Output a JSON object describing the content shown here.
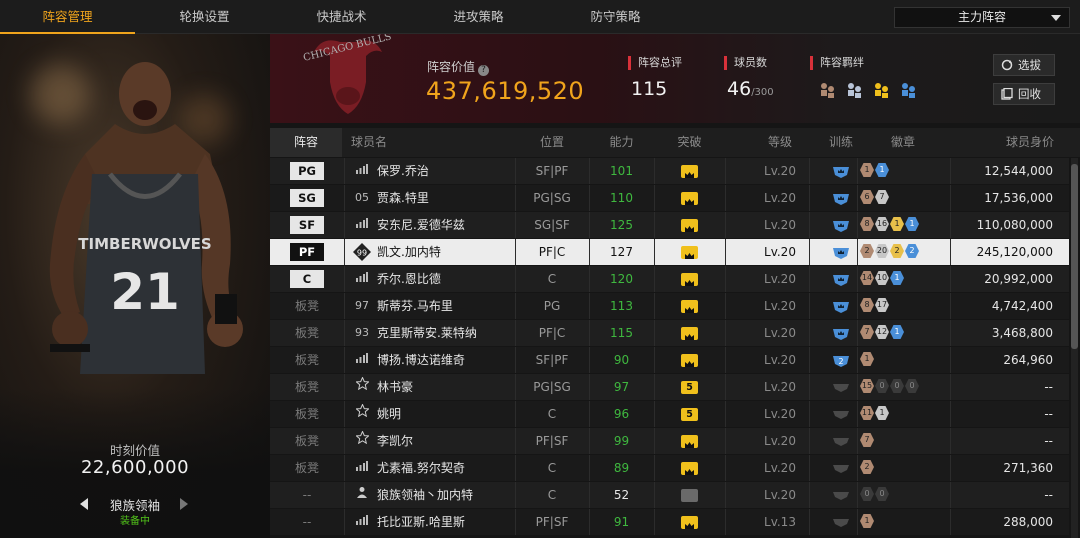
{
  "tabs": [
    {
      "label": "阵容管理",
      "active": true
    },
    {
      "label": "轮换设置",
      "active": false
    },
    {
      "label": "快捷战术",
      "active": false
    },
    {
      "label": "进攻策略",
      "active": false
    },
    {
      "label": "防守策略",
      "active": false
    }
  ],
  "lineup_select": {
    "value": "主力阵容"
  },
  "player_card": {
    "moment_label": "时刻价值",
    "moment_value": "22,600,000",
    "name": "狼族领袖",
    "status": "装备中",
    "jersey": "21",
    "team_text": "TIMBERWOLVES"
  },
  "team": {
    "logo_text": "CHICAGO BULLS",
    "value_label": "阵容价值",
    "value": "437,619,520",
    "rating_label": "阵容总评",
    "rating": "115",
    "count_label": "球员数",
    "count": "46",
    "count_max": "/300",
    "bond_label": "阵容羁绊",
    "select_button": "选拔",
    "recycle_button": "回收"
  },
  "table": {
    "headers": [
      "阵容",
      "球员名",
      "位置",
      "能力",
      "突破",
      "等级",
      "训练",
      "徽章",
      "球员身价"
    ],
    "rows": [
      {
        "slot": "PG",
        "icon": "bars-icon",
        "num": "",
        "name": "保罗.乔治",
        "pos": "SF|PF",
        "ability": "101",
        "ability_color": "green",
        "breakthrough": "gold",
        "level": "Lv.20",
        "train": "blue",
        "badges": [
          {
            "c": "bronze",
            "t": "1"
          },
          {
            "c": "blue",
            "t": "1"
          }
        ],
        "price": "12,544,000"
      },
      {
        "slot": "SG",
        "icon": "",
        "num": "05",
        "name": "贾森.特里",
        "pos": "PG|SG",
        "ability": "110",
        "ability_color": "green",
        "breakthrough": "gold",
        "level": "Lv.20",
        "train": "blue",
        "badges": [
          {
            "c": "bronze",
            "t": "6"
          },
          {
            "c": "silver",
            "t": "7"
          }
        ],
        "price": "17,536,000"
      },
      {
        "slot": "SF",
        "icon": "bars-icon",
        "num": "",
        "name": "安东尼.爱德华兹",
        "pos": "SG|SF",
        "ability": "125",
        "ability_color": "green",
        "breakthrough": "gold",
        "level": "Lv.20",
        "train": "blue",
        "badges": [
          {
            "c": "bronze",
            "t": "8"
          },
          {
            "c": "silver",
            "t": "16"
          },
          {
            "c": "gold",
            "t": "1"
          },
          {
            "c": "blue",
            "t": "1"
          }
        ],
        "price": "110,080,000"
      },
      {
        "slot": "PF",
        "icon": "diamond-icon",
        "num": "99",
        "name": "凯文.加内特",
        "pos": "PF|C",
        "ability": "127",
        "ability_color": "white",
        "breakthrough": "gold",
        "level": "Lv.20",
        "train": "blue",
        "badges": [
          {
            "c": "bronze",
            "t": "2"
          },
          {
            "c": "silver",
            "t": "20"
          },
          {
            "c": "gold",
            "t": "2"
          },
          {
            "c": "blue",
            "t": "2"
          }
        ],
        "price": "245,120,000",
        "selected": true
      },
      {
        "slot": "C",
        "icon": "bars-icon",
        "num": "",
        "name": "乔尔.恩比德",
        "pos": "C",
        "ability": "120",
        "ability_color": "green",
        "breakthrough": "gold",
        "level": "Lv.20",
        "train": "blue",
        "badges": [
          {
            "c": "bronze",
            "t": "14"
          },
          {
            "c": "silver",
            "t": "10"
          },
          {
            "c": "blue",
            "t": "1"
          }
        ],
        "price": "20,992,000"
      },
      {
        "slot": "板凳",
        "icon": "",
        "num": "97",
        "name": "斯蒂芬.马布里",
        "pos": "PG",
        "ability": "113",
        "ability_color": "green",
        "breakthrough": "gold",
        "level": "Lv.20",
        "train": "blue",
        "badges": [
          {
            "c": "bronze",
            "t": "8"
          },
          {
            "c": "silver",
            "t": "17"
          }
        ],
        "price": "4,742,400"
      },
      {
        "slot": "板凳",
        "icon": "",
        "num": "93",
        "name": "克里斯蒂安.莱特纳",
        "pos": "PF|C",
        "ability": "115",
        "ability_color": "green",
        "breakthrough": "gold",
        "level": "Lv.20",
        "train": "blue",
        "badges": [
          {
            "c": "bronze",
            "t": "7"
          },
          {
            "c": "silver",
            "t": "12"
          },
          {
            "c": "blue",
            "t": "1"
          }
        ],
        "price": "3,468,800"
      },
      {
        "slot": "板凳",
        "icon": "bars-icon",
        "num": "",
        "name": "博扬.博达诺维奇",
        "pos": "SF|PF",
        "ability": "90",
        "ability_color": "green",
        "breakthrough": "gold",
        "level": "Lv.20",
        "train": "blue2",
        "badges": [
          {
            "c": "bronze",
            "t": "1"
          }
        ],
        "price": "264,960"
      },
      {
        "slot": "板凳",
        "icon": "star-icon",
        "num": "",
        "name": "林书豪",
        "pos": "PG|SG",
        "ability": "97",
        "ability_color": "green",
        "breakthrough": "five",
        "level": "Lv.20",
        "train": "gray",
        "badges": [
          {
            "c": "bronze",
            "t": "15"
          },
          {
            "c": "dark",
            "t": "0"
          },
          {
            "c": "dark",
            "t": "0"
          },
          {
            "c": "dark",
            "t": "0"
          }
        ],
        "price": "--"
      },
      {
        "slot": "板凳",
        "icon": "star-icon",
        "num": "",
        "name": "姚明",
        "pos": "C",
        "ability": "96",
        "ability_color": "green",
        "breakthrough": "five",
        "level": "Lv.20",
        "train": "gray",
        "badges": [
          {
            "c": "bronze",
            "t": "11"
          },
          {
            "c": "silver",
            "t": "1"
          }
        ],
        "price": "--"
      },
      {
        "slot": "板凳",
        "icon": "star-icon",
        "num": "",
        "name": "李凯尔",
        "pos": "PF|SF",
        "ability": "99",
        "ability_color": "green",
        "breakthrough": "gold",
        "level": "Lv.20",
        "train": "gray",
        "badges": [
          {
            "c": "bronze",
            "t": "7"
          }
        ],
        "price": "--"
      },
      {
        "slot": "板凳",
        "icon": "bars-icon",
        "num": "",
        "name": "尤素福.努尔契奇",
        "pos": "C",
        "ability": "89",
        "ability_color": "green",
        "breakthrough": "gold",
        "level": "Lv.20",
        "train": "gray",
        "badges": [
          {
            "c": "bronze",
            "t": "2"
          }
        ],
        "price": "271,360"
      },
      {
        "slot": "--",
        "icon": "person-icon",
        "num": "",
        "name": "狼族领袖丶加内特",
        "pos": "C",
        "ability": "52",
        "ability_color": "white",
        "breakthrough": "grayc",
        "level": "Lv.20",
        "train": "gray",
        "badges": [
          {
            "c": "dark",
            "t": "0"
          },
          {
            "c": "dark",
            "t": "0"
          }
        ],
        "price": "--"
      },
      {
        "slot": "--",
        "icon": "bars-icon",
        "num": "",
        "name": "托比亚斯.哈里斯",
        "pos": "PF|SF",
        "ability": "91",
        "ability_color": "green",
        "breakthrough": "gold",
        "level": "Lv.13",
        "train": "gray",
        "badges": [
          {
            "c": "bronze",
            "t": "1"
          }
        ],
        "price": "288,000"
      }
    ]
  },
  "colors": {
    "accent": "#f0a41c",
    "ability_green": "#3fb83f",
    "selected_row": "#ececec",
    "status_red": "#d9313a"
  }
}
